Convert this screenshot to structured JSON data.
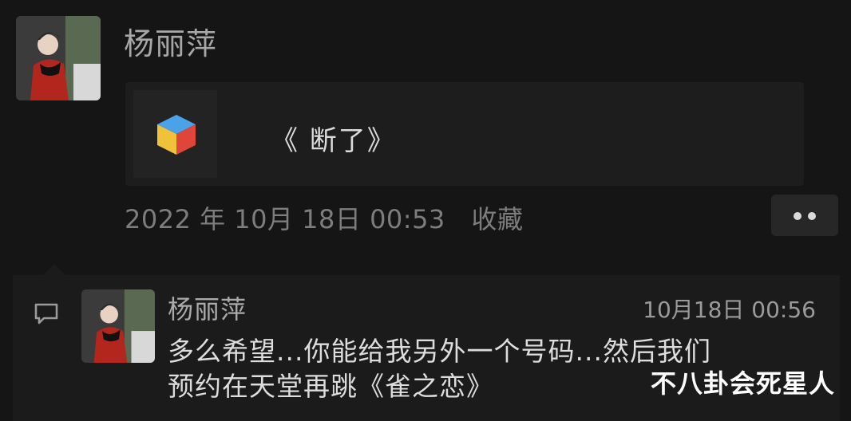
{
  "post": {
    "author": "杨丽萍",
    "share_title": "《 断了》",
    "timestamp": "2022 年 10月 18日 00:53",
    "favorite_label": "收藏"
  },
  "comment": {
    "author": "杨丽萍",
    "time": "10月18日 00:56",
    "text_line1": "多么希望...你能给我另外一个号码...然后我们",
    "text_line2": "预约在天堂再跳《雀之恋》"
  },
  "watermark": "不八卦会死星人",
  "colors": {
    "background": "#151515",
    "card": "#1d1d1d",
    "comment_background": "#1b1b1b",
    "cube_top": "#4aa3e8",
    "cube_left": "#f0c23a",
    "cube_right": "#e0453a"
  },
  "icons": {
    "app_icon": "cube-icon",
    "comment_icon": "speech-bubble-icon",
    "more_icon": "more-dots-icon"
  }
}
